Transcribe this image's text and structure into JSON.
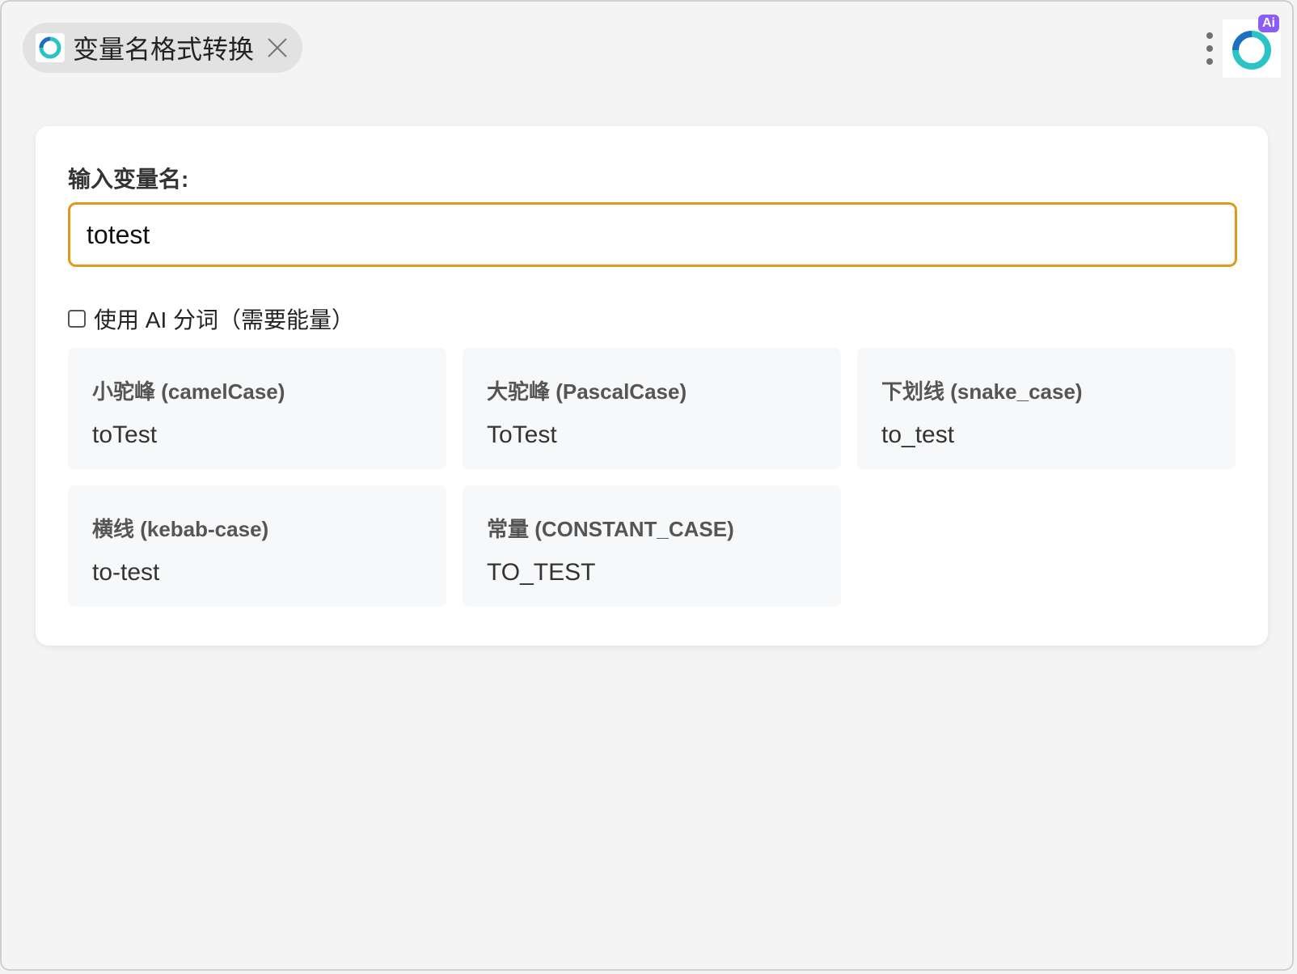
{
  "tab": {
    "title": "变量名格式转换",
    "close_icon": "close-icon",
    "logo_icon": "app-logo-icon"
  },
  "toolbar": {
    "more_icon": "more-vertical-icon",
    "app_logo_badge": "Ai"
  },
  "form": {
    "label": "输入变量名:",
    "input_value": "totest",
    "ai_checkbox_label": "使用 AI 分词（需要能量）",
    "ai_checkbox_checked": false
  },
  "results": [
    {
      "title": "小驼峰 (camelCase)",
      "value": "toTest"
    },
    {
      "title": "大驼峰 (PascalCase)",
      "value": "ToTest"
    },
    {
      "title": "下划线 (snake_case)",
      "value": "to_test"
    },
    {
      "title": "横线 (kebab-case)",
      "value": "to-test"
    },
    {
      "title": "常量 (CONSTANT_CASE)",
      "value": "TO_TEST"
    }
  ],
  "colors": {
    "input_border": "#e0991f",
    "ai_badge": "#8b5cf6",
    "logo_blue": "#1f6fc0",
    "logo_teal": "#2bc3c3"
  }
}
